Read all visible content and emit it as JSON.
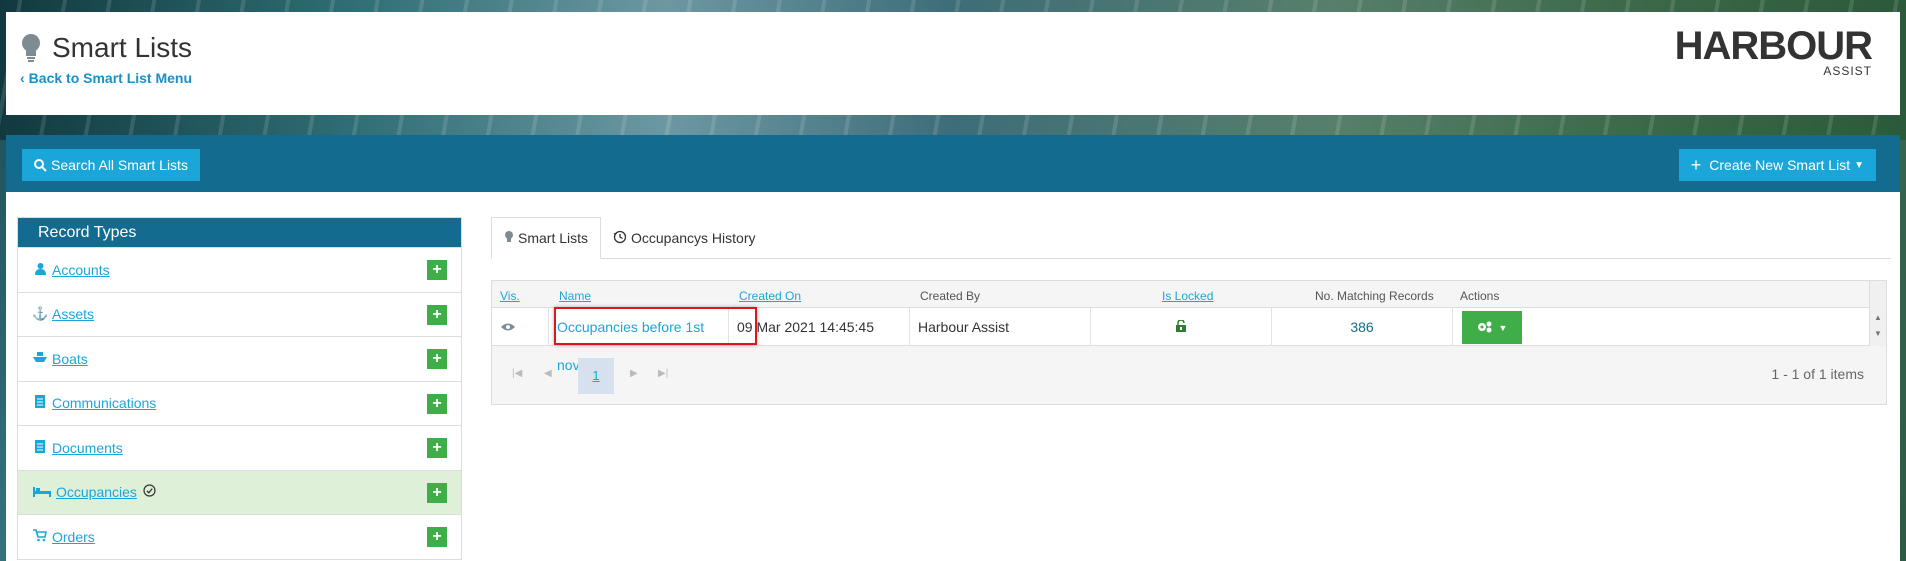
{
  "header": {
    "title": "Smart Lists",
    "back_link": "Back to Smart List Menu",
    "logo_main": "HARBOUR",
    "logo_sub": "ASSIST"
  },
  "toolbar": {
    "search_label": "Search All Smart Lists",
    "create_label": "Create New Smart List"
  },
  "record_types": {
    "heading": "Record Types",
    "items": [
      {
        "label": "Accounts",
        "icon": "user-icon"
      },
      {
        "label": "Assets",
        "icon": "anchor-icon"
      },
      {
        "label": "Boats",
        "icon": "boat-icon"
      },
      {
        "label": "Communications",
        "icon": "document-icon"
      },
      {
        "label": "Documents",
        "icon": "document-icon"
      },
      {
        "label": "Occupancies",
        "icon": "bed-icon",
        "active": true
      },
      {
        "label": "Orders",
        "icon": "cart-icon"
      }
    ]
  },
  "tabs": [
    {
      "label": "Smart Lists",
      "icon": "bulb-icon",
      "active": true
    },
    {
      "label": "Occupancys History",
      "icon": "history-icon"
    }
  ],
  "grid": {
    "columns": {
      "vis": "Vis.",
      "name": "Name",
      "created_on": "Created On",
      "created_by": "Created By",
      "is_locked": "Is Locked",
      "matching": "No. Matching Records",
      "actions": "Actions"
    },
    "rows": [
      {
        "name": "Occupancies before 1st nov",
        "created_on": "09 Mar 2021 14:45:45",
        "created_by": "Harbour Assist",
        "locked": "unlocked",
        "matching": "386"
      }
    ],
    "pager": {
      "current_page": "1",
      "info": "1 - 1 of 1 items"
    }
  },
  "colors": {
    "accent": "#1ba6d9",
    "bar": "#136c8f",
    "green": "#3fae49",
    "highlight": "#d9181e"
  }
}
